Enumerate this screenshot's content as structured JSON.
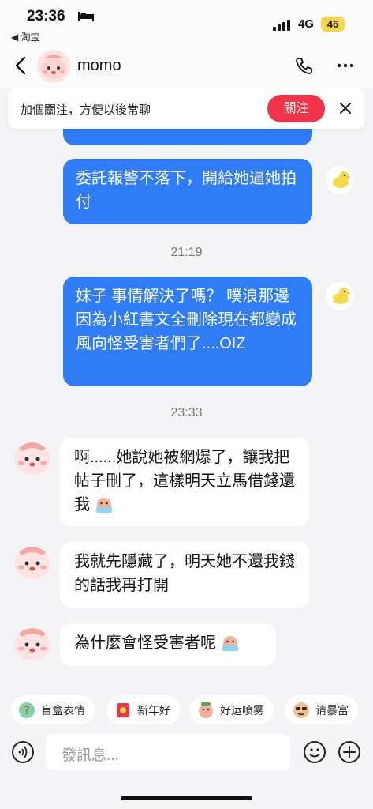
{
  "status_bar": {
    "time": "23:36",
    "back_app": "◀ 淘宝",
    "network": "4G",
    "battery": "46"
  },
  "header": {
    "contact_name": "momo"
  },
  "follow_banner": {
    "text": "加個關注，方便以後常聊",
    "button": "關注"
  },
  "messages": {
    "out_1": "委託報警不落下，開給她逼她拍付",
    "time_1": "21:19",
    "out_2": "妹子 事情解決了嗎？ 噗浪那邊因為小紅書文全刪除現在都變成風向怪受害者們了....OIZ",
    "time_2": "23:33",
    "in_1": "啊......她說她被網爆了，讓我把帖子刪了，這樣明天立馬借錢還我",
    "in_2": "我就先隱藏了，明天她不還我錢的話我再打開",
    "in_3": "為什麼會怪受害者呢"
  },
  "sticker_chips": [
    {
      "label": "盲盒表情",
      "icon": "mystery-box-icon"
    },
    {
      "label": "新年好",
      "icon": "new-year-icon"
    },
    {
      "label": "好运喷雾",
      "icon": "lucky-spray-icon"
    },
    {
      "label": "请暴富",
      "icon": "rich-icon"
    }
  ],
  "input": {
    "placeholder": "發訊息..."
  },
  "colors": {
    "outgoing_bubble": "#2f7cf6",
    "follow_button": "#f0334a",
    "battery": "#f6d64a"
  }
}
